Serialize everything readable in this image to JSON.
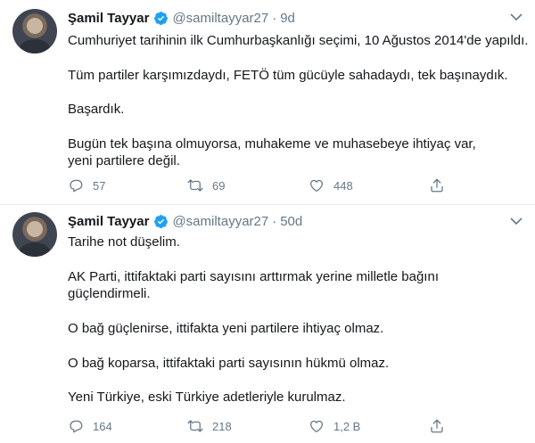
{
  "tweets": [
    {
      "display_name": "Şamil Tayyar",
      "handle": "@samiltayyar27",
      "separator": "·",
      "time": "9d",
      "paragraphs": [
        "Cumhuriyet tarihinin ilk Cumhurbaşkanlığı seçimi, 10 Ağustos 2014'de yapıldı.",
        "Tüm partiler karşımızdaydı, FETÖ tüm gücüyle sahadaydı, tek başınaydık.",
        "Başardık.",
        "Bugün tek başına olmuyorsa, muhakeme ve muhasebeye ihtiyaç var, yeni partilere değil."
      ],
      "replies": "57",
      "retweets": "69",
      "likes": "448"
    },
    {
      "display_name": "Şamil Tayyar",
      "handle": "@samiltayyar27",
      "separator": "·",
      "time": "50d",
      "paragraphs": [
        "Tarihe not düşelim.",
        "AK Parti, ittifaktaki parti sayısını arttırmak yerine milletle bağını güçlendirmeli.",
        "O bağ güçlenirse, ittifakta yeni partilere ihtiyaç olmaz.",
        "O bağ koparsa, ittifaktaki parti sayısının hükmü olmaz.",
        "Yeni Türkiye, eski Türkiye adetleriyle kurulmaz."
      ],
      "replies": "164",
      "retweets": "218",
      "likes": "1,2 B"
    }
  ],
  "colors": {
    "text": "#14171a",
    "secondary": "#657786",
    "verified": "#1da1f2",
    "divider": "#e6ecf0"
  },
  "icons": [
    "verified-badge-icon",
    "caret-down-icon",
    "reply-icon",
    "retweet-icon",
    "like-icon",
    "share-icon"
  ]
}
